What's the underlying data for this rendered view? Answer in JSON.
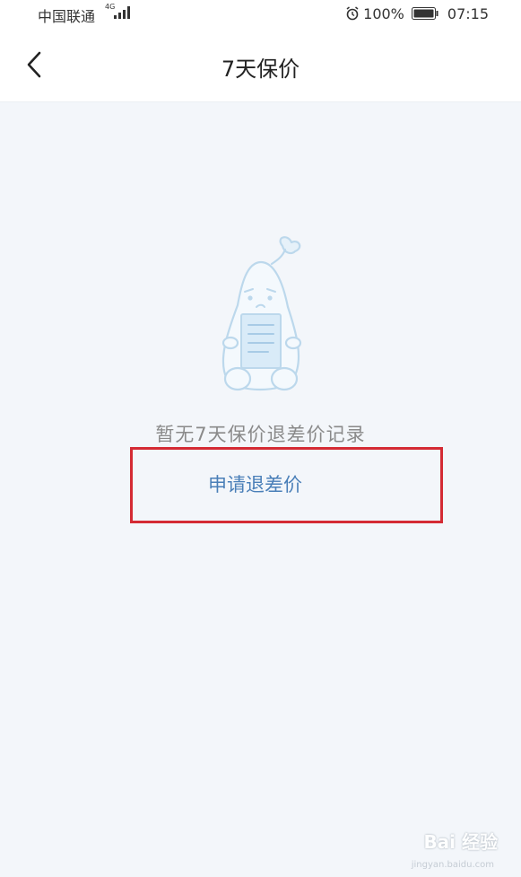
{
  "status_bar": {
    "carrier": "中国联通",
    "network_badge": "4G",
    "battery_percent": "100%",
    "time": "07:15"
  },
  "header": {
    "title": "7天保价",
    "back_icon": "chevron-left-icon"
  },
  "empty_state": {
    "illustration": "mascot-holding-document",
    "message": "暂无7天保价退差价记录",
    "action_label": "申请退差价",
    "highlight_color": "#d42b34"
  },
  "watermark": {
    "brand": "Bai 经验",
    "url": "jingyan.baidu.com"
  },
  "colors": {
    "background": "#f3f6fa",
    "link": "#4a7fb8",
    "illustration": "#bcd8ec"
  }
}
